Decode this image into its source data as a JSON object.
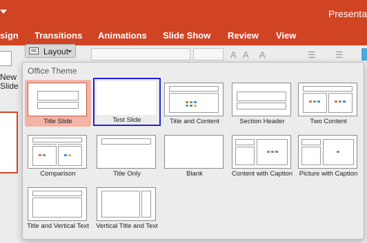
{
  "app": {
    "title": "Presenta"
  },
  "ribbon_tabs": [
    "sign",
    "Transitions",
    "Animations",
    "Slide Show",
    "Review",
    "View"
  ],
  "ribbon": {
    "new_slide_label": "New Slide",
    "layout_button_label": "Layout"
  },
  "colors": {
    "accent": "#d04424",
    "selected": "#f3b4a7",
    "hover_border": "#1f1fd8"
  },
  "gallery": {
    "title": "Office Theme",
    "selected_layout": "Title Slide",
    "hovered_layout": "Test Slide",
    "layouts": [
      {
        "label": "Title Slide",
        "kind": "title"
      },
      {
        "label": "Test Slide",
        "kind": "blank"
      },
      {
        "label": "Title and Content",
        "kind": "title-content"
      },
      {
        "label": "Section Header",
        "kind": "section"
      },
      {
        "label": "Two Content",
        "kind": "two-content"
      },
      {
        "label": "Comparison",
        "kind": "comparison"
      },
      {
        "label": "Title Only",
        "kind": "title-only"
      },
      {
        "label": "Blank",
        "kind": "blank"
      },
      {
        "label": "Content with Caption",
        "kind": "content-caption"
      },
      {
        "label": "Picture with Caption",
        "kind": "picture-caption"
      },
      {
        "label": "Title and Vertical Text",
        "kind": "vertical-text"
      },
      {
        "label": "Vertical Title and Text",
        "kind": "vertical-title"
      }
    ]
  }
}
